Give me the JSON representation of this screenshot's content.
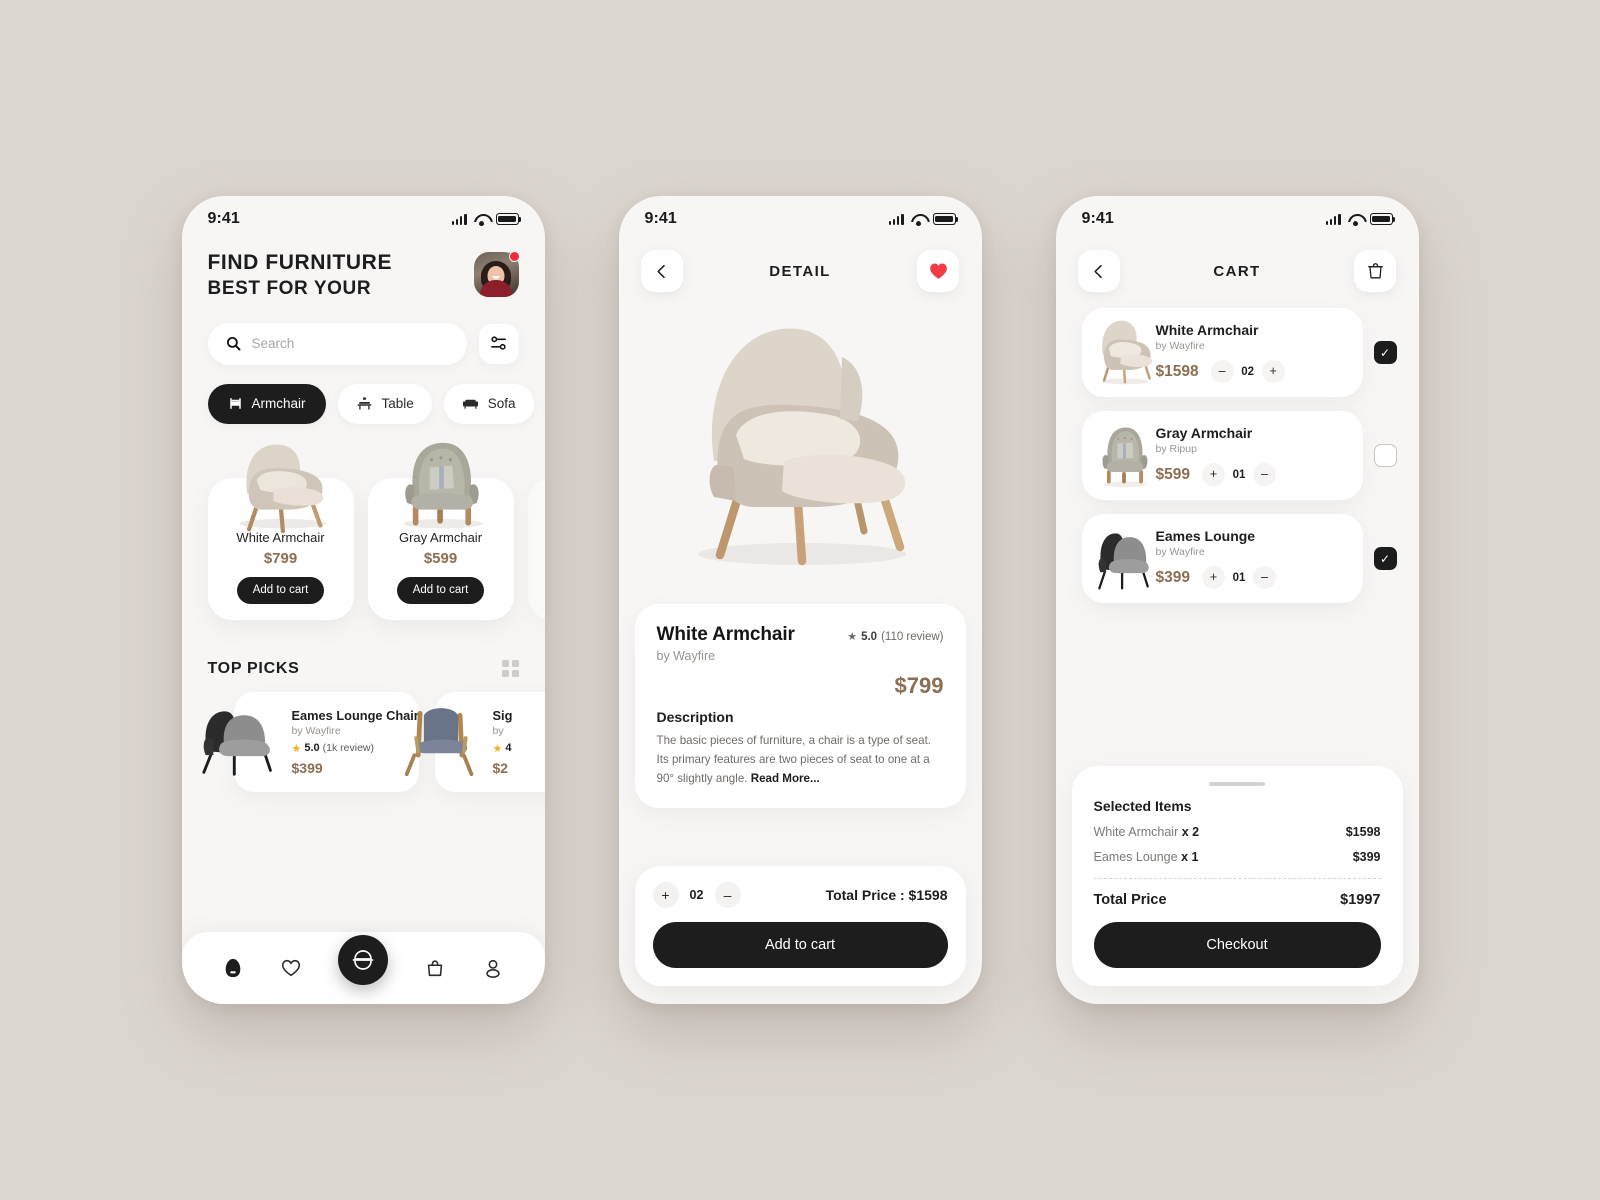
{
  "status_bar": {
    "time": "9:41"
  },
  "colors": {
    "background": "#dcd6d0",
    "screen": "#f7f6f5",
    "price": "#8c6e52",
    "dark": "#1d1d1d",
    "heart": "#ee2b3a",
    "star": "#f2b01e"
  },
  "home": {
    "title_line1": "FIND FURNITURE",
    "title_line2": "BEST FOR YOUR",
    "search": {
      "placeholder": "Search",
      "value": ""
    },
    "categories": [
      {
        "label": "Armchair",
        "icon": "armchair-icon",
        "active": true
      },
      {
        "label": "Table",
        "icon": "table-icon",
        "active": false
      },
      {
        "label": "Sofa",
        "icon": "sofa-icon",
        "active": false
      }
    ],
    "products": [
      {
        "name": "White Armchair",
        "price": "$799",
        "cta": "Add to cart"
      },
      {
        "name": "Gray Armchair",
        "price": "$599",
        "cta": "Add to cart"
      }
    ],
    "top_picks_title": "TOP PICKS",
    "top_picks": [
      {
        "name": "Eames Lounge Chair",
        "by": "by Wayfire",
        "rating": "5.0",
        "reviews": "(1k review)",
        "price": "$399"
      },
      {
        "name": "Sig",
        "by": "by",
        "rating": "4",
        "reviews": "",
        "price": "$2"
      }
    ],
    "tabs": [
      {
        "name": "home-tab",
        "icon": "home-icon",
        "active": true
      },
      {
        "name": "favorites-tab",
        "icon": "heart-icon",
        "active": false
      },
      {
        "name": "scan-tab",
        "icon": "scan-icon",
        "active": true
      },
      {
        "name": "bag-tab",
        "icon": "bag-icon",
        "active": false
      },
      {
        "name": "profile-tab",
        "icon": "user-icon",
        "active": false
      }
    ]
  },
  "detail": {
    "nav_title": "DETAIL",
    "back_icon": "chevron-left-icon",
    "favorite_icon": "heart-filled-icon",
    "product": {
      "name": "White Armchair",
      "by": "by Wayfire",
      "rating": "5.0",
      "reviews": "(110 review)",
      "price": "$799"
    },
    "description_heading": "Description",
    "description": "The basic pieces of furniture, a chair is a type of seat. Its primary features are two pieces of seat to one at a 90° slightly angle. ",
    "read_more": "Read More...",
    "quantity": "02",
    "plus": "+",
    "minus": "–",
    "total_label": "Total Price : $1598",
    "cta": "Add to cart"
  },
  "cart": {
    "nav_title": "CART",
    "back_icon": "chevron-left-icon",
    "delete_icon": "trash-icon",
    "items": [
      {
        "name": "White Armchair",
        "by": "by Wayfire",
        "price": "$1598",
        "qty": "02",
        "first_op": "–",
        "second_op": "+",
        "checked": true
      },
      {
        "name": "Gray Armchair",
        "by": "by Ripup",
        "price": "$599",
        "qty": "01",
        "first_op": "+",
        "second_op": "–",
        "checked": false
      },
      {
        "name": "Eames Lounge",
        "by": "by Wayfire",
        "price": "$399",
        "qty": "01",
        "first_op": "+",
        "second_op": "–",
        "checked": true
      }
    ],
    "summary_title": "Selected Items",
    "summary_lines": [
      {
        "label": "White  Armchair",
        "qty": "x 2",
        "amount": "$1598"
      },
      {
        "label": "Eames Lounge",
        "qty": "x 1",
        "amount": "$399"
      }
    ],
    "total_label": "Total Price",
    "total_amount": "$1997",
    "cta": "Checkout"
  }
}
